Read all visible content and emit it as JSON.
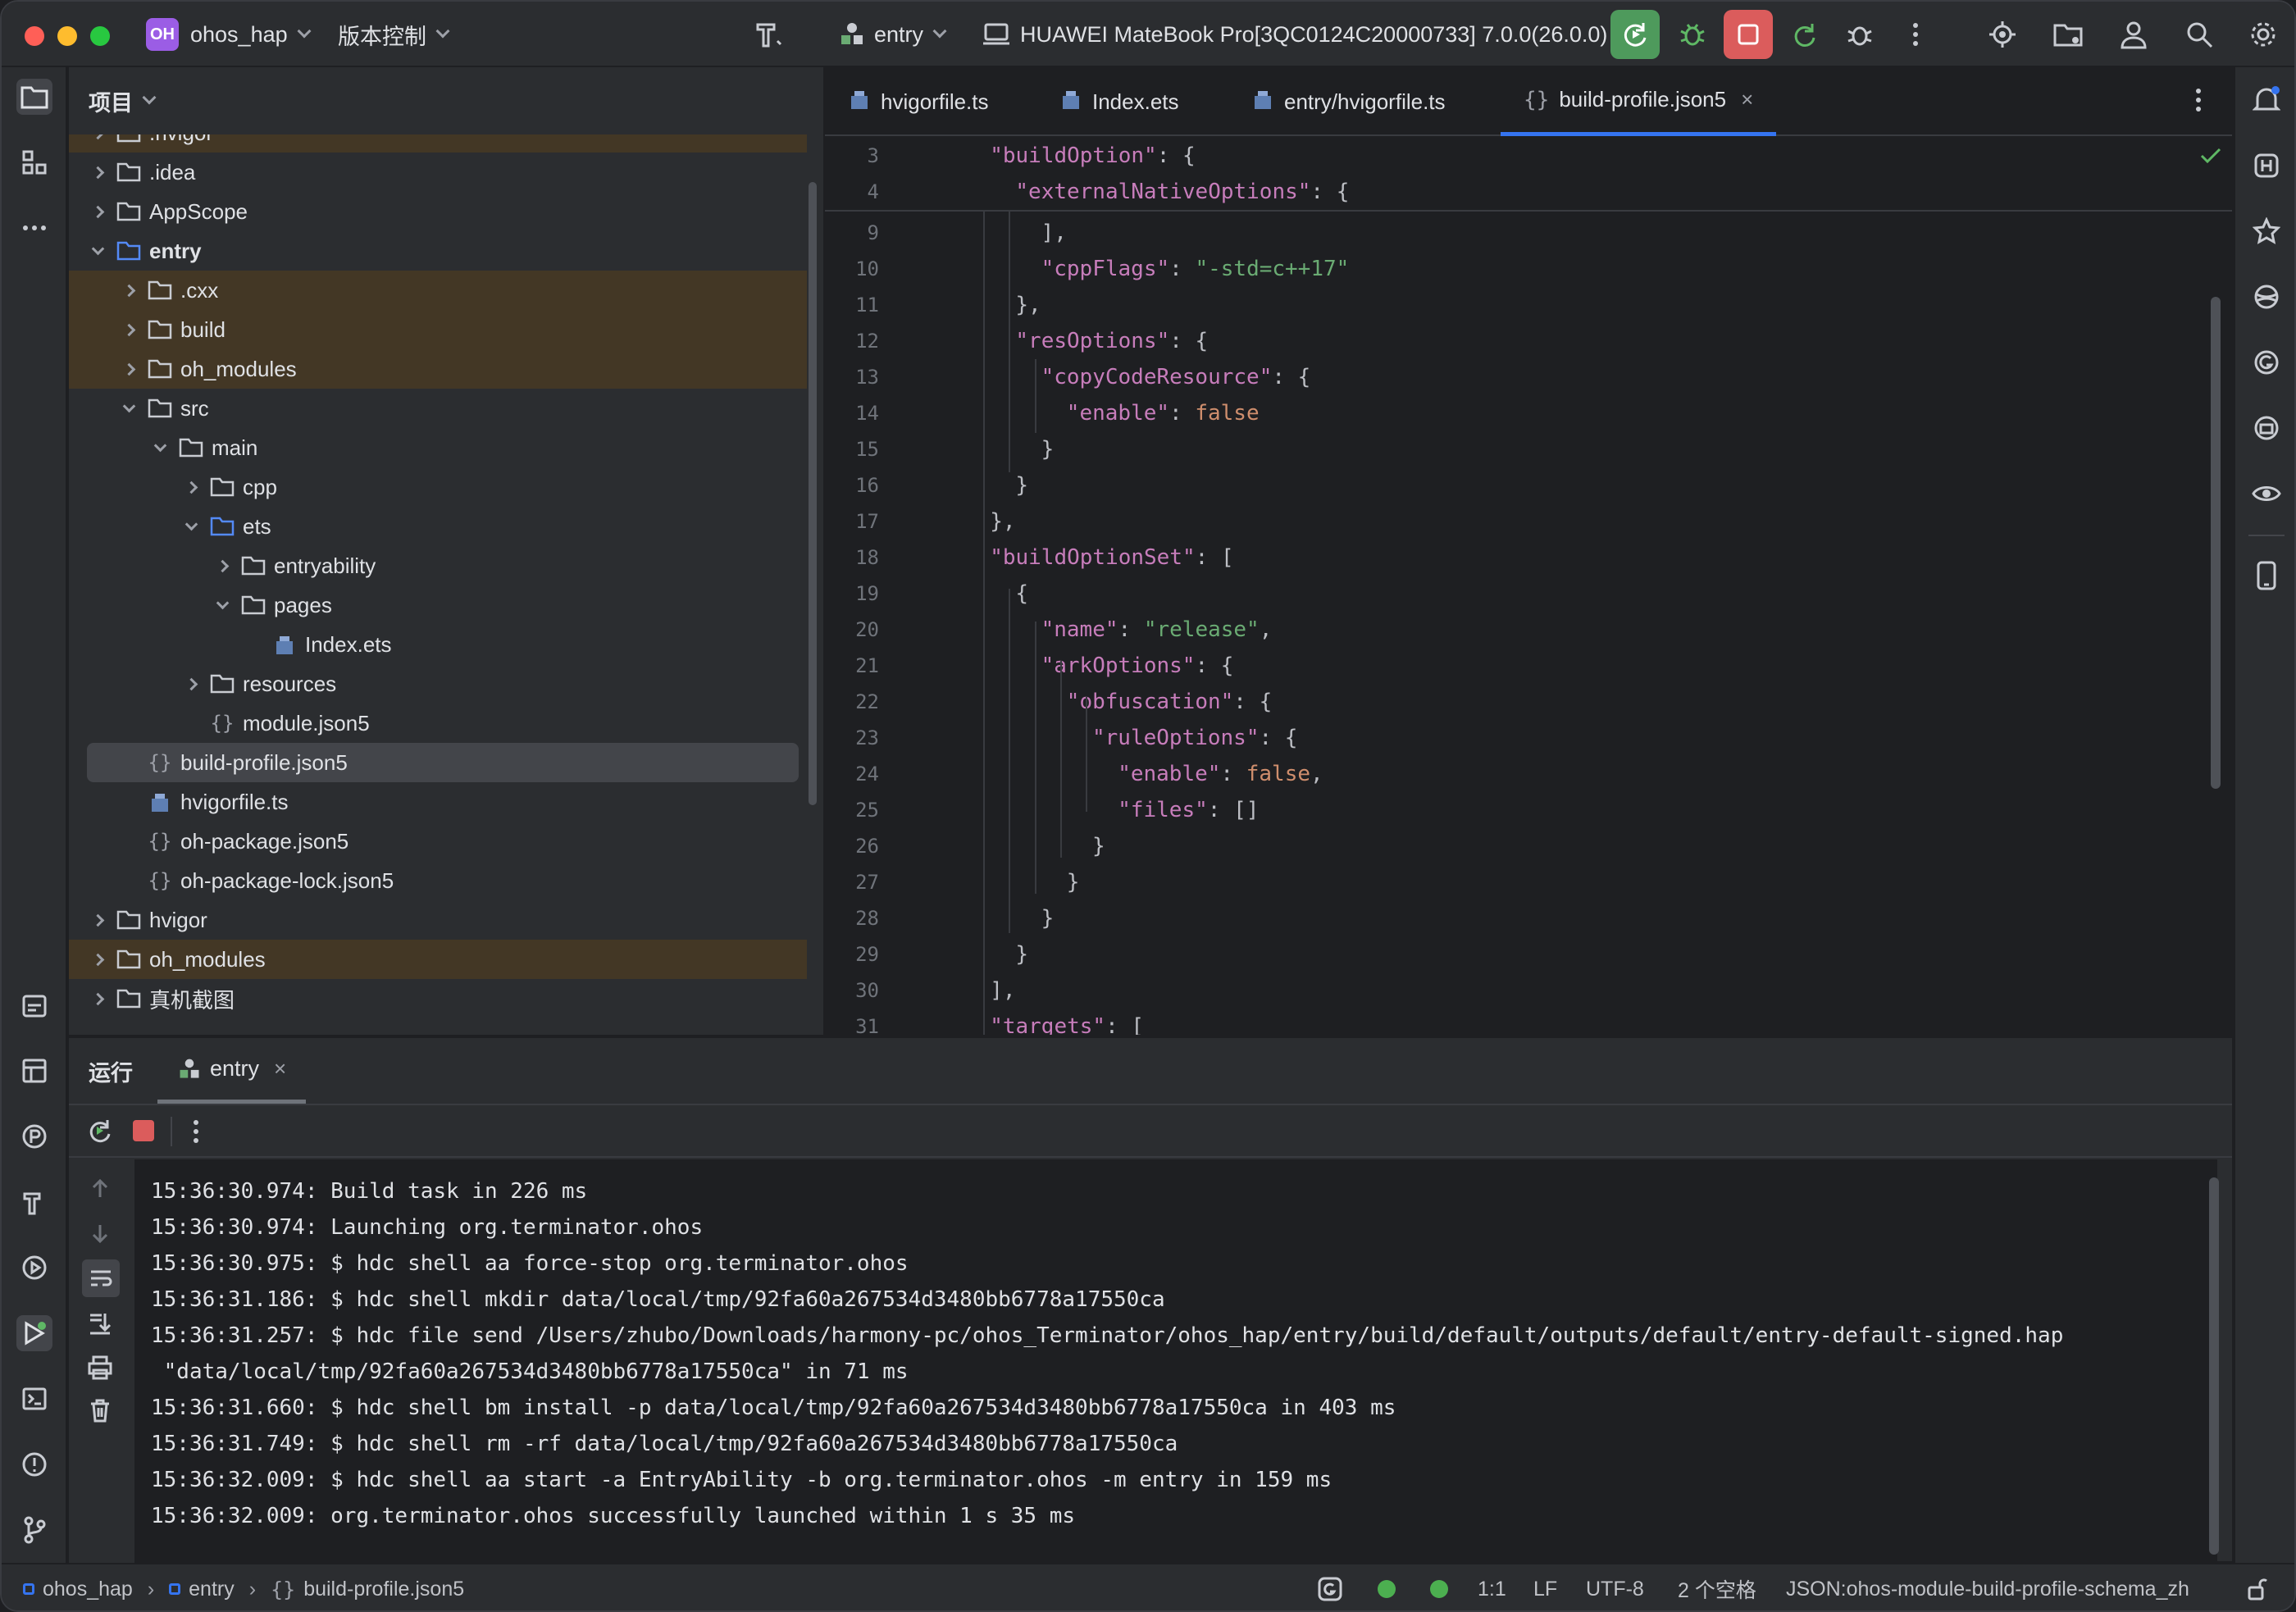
{
  "titlebar": {
    "project_badge": "OH",
    "project_name": "ohos_hap",
    "vcs_label": "版本控制",
    "run_config": "entry",
    "device": "HUAWEI MateBook Pro[3QC0124C20000733] 7.0.0(26.0.0)"
  },
  "project_panel": {
    "title": "项目",
    "tree": [
      {
        "label": ".hvigor",
        "level": 1,
        "expand": "right",
        "excluded": true,
        "icon": "folder-icon"
      },
      {
        "label": ".idea",
        "level": 1,
        "expand": "right",
        "excluded": false,
        "icon": "folder-icon"
      },
      {
        "label": "AppScope",
        "level": 1,
        "expand": "right",
        "excluded": false,
        "icon": "folder-icon"
      },
      {
        "label": "entry",
        "level": 1,
        "expand": "down",
        "excluded": false,
        "icon": "module-folder-icon",
        "bold": true
      },
      {
        "label": ".cxx",
        "level": 2,
        "expand": "right",
        "excluded": true,
        "icon": "folder-icon"
      },
      {
        "label": "build",
        "level": 2,
        "expand": "right",
        "excluded": true,
        "icon": "folder-icon"
      },
      {
        "label": "oh_modules",
        "level": 2,
        "expand": "right",
        "excluded": true,
        "icon": "folder-icon"
      },
      {
        "label": "src",
        "level": 2,
        "expand": "down",
        "excluded": false,
        "icon": "folder-icon"
      },
      {
        "label": "main",
        "level": 3,
        "expand": "down",
        "excluded": false,
        "icon": "folder-icon"
      },
      {
        "label": "cpp",
        "level": 4,
        "expand": "right",
        "excluded": false,
        "icon": "folder-icon"
      },
      {
        "label": "ets",
        "level": 4,
        "expand": "down",
        "excluded": false,
        "icon": "source-folder-icon"
      },
      {
        "label": "entryability",
        "level": 5,
        "expand": "right",
        "excluded": false,
        "icon": "folder-icon"
      },
      {
        "label": "pages",
        "level": 5,
        "expand": "down",
        "excluded": false,
        "icon": "folder-icon"
      },
      {
        "label": "Index.ets",
        "level": 6,
        "expand": "none",
        "excluded": false,
        "icon": "ets-file-icon"
      },
      {
        "label": "resources",
        "level": 4,
        "expand": "right",
        "excluded": false,
        "icon": "folder-icon"
      },
      {
        "label": "module.json5",
        "level": 4,
        "expand": "none",
        "excluded": false,
        "icon": "json-file-icon"
      },
      {
        "label": "build-profile.json5",
        "level": 2,
        "expand": "none",
        "excluded": false,
        "icon": "json-file-icon",
        "selected": true
      },
      {
        "label": "hvigorfile.ts",
        "level": 2,
        "expand": "none",
        "excluded": false,
        "icon": "ts-file-icon"
      },
      {
        "label": "oh-package.json5",
        "level": 2,
        "expand": "none",
        "excluded": false,
        "icon": "json-file-icon"
      },
      {
        "label": "oh-package-lock.json5",
        "level": 2,
        "expand": "none",
        "excluded": false,
        "icon": "json-file-icon"
      },
      {
        "label": "hvigor",
        "level": 1,
        "expand": "right",
        "excluded": false,
        "icon": "folder-icon"
      },
      {
        "label": "oh_modules",
        "level": 1,
        "expand": "right",
        "excluded": true,
        "icon": "folder-icon"
      },
      {
        "label": "真机截图",
        "level": 1,
        "expand": "right",
        "excluded": false,
        "icon": "folder-icon"
      }
    ]
  },
  "editor": {
    "tabs": [
      {
        "label": "hvigorfile.ts",
        "icon": "ts-file-icon",
        "active": false
      },
      {
        "label": "Index.ets",
        "icon": "ets-file-icon",
        "active": false
      },
      {
        "label": "entry/hvigorfile.ts",
        "icon": "ts-file-icon",
        "active": false
      },
      {
        "label": "build-profile.json5",
        "icon": "json-file-icon",
        "active": true,
        "closable": true
      }
    ],
    "sticky_lines": [
      {
        "n": "3",
        "indent": 1,
        "parts": [
          [
            "key",
            "\"buildOption\""
          ],
          [
            "p",
            ": {"
          ]
        ]
      },
      {
        "n": "4",
        "indent": 2,
        "parts": [
          [
            "key",
            "\"externalNativeOptions\""
          ],
          [
            "p",
            ": {"
          ]
        ]
      }
    ],
    "lines": [
      {
        "n": "9",
        "indent": 3,
        "parts": [
          [
            "p",
            "],"
          ]
        ]
      },
      {
        "n": "10",
        "indent": 3,
        "parts": [
          [
            "key",
            "\"cppFlags\""
          ],
          [
            "p",
            ": "
          ],
          [
            "str",
            "\"-std=c++17\""
          ]
        ]
      },
      {
        "n": "11",
        "indent": 2,
        "parts": [
          [
            "p",
            "},"
          ]
        ]
      },
      {
        "n": "12",
        "indent": 2,
        "parts": [
          [
            "key",
            "\"resOptions\""
          ],
          [
            "p",
            ": {"
          ]
        ]
      },
      {
        "n": "13",
        "indent": 3,
        "parts": [
          [
            "key",
            "\"copyCodeResource\""
          ],
          [
            "p",
            ": {"
          ]
        ]
      },
      {
        "n": "14",
        "indent": 4,
        "parts": [
          [
            "key",
            "\"enable\""
          ],
          [
            "p",
            ": "
          ],
          [
            "kw",
            "false"
          ]
        ]
      },
      {
        "n": "15",
        "indent": 3,
        "parts": [
          [
            "p",
            "}"
          ]
        ]
      },
      {
        "n": "16",
        "indent": 2,
        "parts": [
          [
            "p",
            "}"
          ]
        ]
      },
      {
        "n": "17",
        "indent": 1,
        "parts": [
          [
            "p",
            "},"
          ]
        ]
      },
      {
        "n": "18",
        "indent": 1,
        "parts": [
          [
            "key",
            "\"buildOptionSet\""
          ],
          [
            "p",
            ": ["
          ]
        ]
      },
      {
        "n": "19",
        "indent": 2,
        "parts": [
          [
            "p",
            "{"
          ]
        ]
      },
      {
        "n": "20",
        "indent": 3,
        "parts": [
          [
            "key",
            "\"name\""
          ],
          [
            "p",
            ": "
          ],
          [
            "str",
            "\"release\""
          ],
          [
            "p",
            ","
          ]
        ]
      },
      {
        "n": "21",
        "indent": 3,
        "parts": [
          [
            "key",
            "\"arkOptions\""
          ],
          [
            "p",
            ": {"
          ]
        ]
      },
      {
        "n": "22",
        "indent": 4,
        "parts": [
          [
            "key",
            "\"obfuscation\""
          ],
          [
            "p",
            ": {"
          ]
        ]
      },
      {
        "n": "23",
        "indent": 5,
        "parts": [
          [
            "key",
            "\"ruleOptions\""
          ],
          [
            "p",
            ": {"
          ]
        ]
      },
      {
        "n": "24",
        "indent": 6,
        "parts": [
          [
            "key",
            "\"enable\""
          ],
          [
            "p",
            ": "
          ],
          [
            "kw",
            "false"
          ],
          [
            "p",
            ","
          ]
        ]
      },
      {
        "n": "25",
        "indent": 6,
        "parts": [
          [
            "key",
            "\"files\""
          ],
          [
            "p",
            ": []"
          ]
        ]
      },
      {
        "n": "26",
        "indent": 5,
        "parts": [
          [
            "p",
            "}"
          ]
        ]
      },
      {
        "n": "27",
        "indent": 4,
        "parts": [
          [
            "p",
            "}"
          ]
        ]
      },
      {
        "n": "28",
        "indent": 3,
        "parts": [
          [
            "p",
            "}"
          ]
        ]
      },
      {
        "n": "29",
        "indent": 2,
        "parts": [
          [
            "p",
            "}"
          ]
        ]
      },
      {
        "n": "30",
        "indent": 1,
        "parts": [
          [
            "p",
            "],"
          ]
        ]
      },
      {
        "n": "31",
        "indent": 1,
        "parts": [
          [
            "key",
            "\"targets\""
          ],
          [
            "p",
            ": ["
          ]
        ]
      }
    ]
  },
  "run_panel": {
    "title": "运行",
    "tab_label": "entry",
    "console_lines": [
      "15:36:30.974: Build task in 226 ms",
      "15:36:30.974: Launching org.terminator.ohos",
      "15:36:30.975: $ hdc shell aa force-stop org.terminator.ohos",
      "15:36:31.186: $ hdc shell mkdir data/local/tmp/92fa60a267534d3480bb6778a17550ca",
      "15:36:31.257: $ hdc file send /Users/zhubo/Downloads/harmony-pc/ohos_Terminator/ohos_hap/entry/build/default/outputs/default/entry-default-signed.hap",
      " \"data/local/tmp/92fa60a267534d3480bb6778a17550ca\" in 71 ms",
      "15:36:31.660: $ hdc shell bm install -p data/local/tmp/92fa60a267534d3480bb6778a17550ca in 403 ms",
      "15:36:31.749: $ hdc shell rm -rf data/local/tmp/92fa60a267534d3480bb6778a17550ca",
      "15:36:32.009: $ hdc shell aa start -a EntryAbility -b org.terminator.ohos -m entry in 159 ms",
      "15:36:32.009: org.terminator.ohos successfully launched within 1 s 35 ms"
    ]
  },
  "statusbar": {
    "crumb_project": "ohos_hap",
    "crumb_module": "entry",
    "crumb_file": "build-profile.json5",
    "position": "1:1",
    "line_sep": "LF",
    "encoding": "UTF-8",
    "indent": "2 个空格",
    "schema": "JSON:ohos-module-build-profile-schema_zh"
  },
  "colors": {
    "accent": "#3574f0",
    "excluded_row": "#433725",
    "json_key": "#c77dbb",
    "json_string": "#6aab73",
    "json_keyword": "#cf8e6d",
    "run_green": "#4caf50",
    "stop_red": "#db5c5c"
  }
}
